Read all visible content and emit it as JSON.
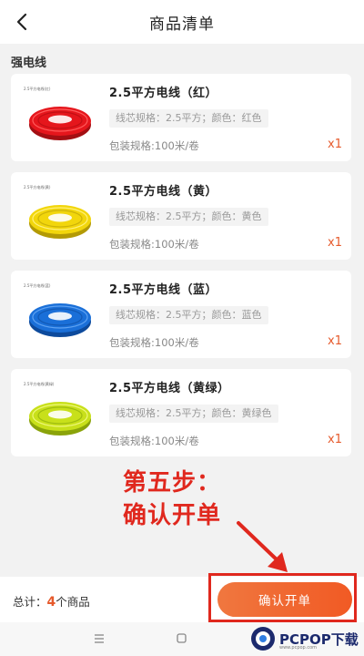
{
  "header": {
    "title": "商品清单"
  },
  "section": {
    "title": "强电线"
  },
  "products": [
    {
      "name": "2.5平方电线（红）",
      "spec": "线芯规格：2.5平方；颜色：红色",
      "pack": "包装规格:100米/卷",
      "qty": "x1",
      "thumb_caption": "2.5平方电线(红)",
      "color": "#e5161c"
    },
    {
      "name": "2.5平方电线（黄）",
      "spec": "线芯规格：2.5平方；颜色：黄色",
      "pack": "包装规格:100米/卷",
      "qty": "x1",
      "thumb_caption": "2.5平方电线(黄)",
      "color": "#f2d60c"
    },
    {
      "name": "2.5平方电线（蓝）",
      "spec": "线芯规格：2.5平方；颜色：蓝色",
      "pack": "包装规格:100米/卷",
      "qty": "x1",
      "thumb_caption": "2.5平方电线(蓝)",
      "color": "#1a6fd8"
    },
    {
      "name": "2.5平方电线（黄绿）",
      "spec": "线芯规格：2.5平方；颜色：黄绿色",
      "pack": "包装规格:100米/卷",
      "qty": "x1",
      "thumb_caption": "2.5平方电线(黄绿)",
      "color": "#c8e01a"
    }
  ],
  "annotation": {
    "line1": "第五步：",
    "line2": "确认开单",
    "color": "#e0281e"
  },
  "footer": {
    "total_prefix": "总计：",
    "total_count": "4",
    "total_suffix": "个商品",
    "confirm_label": "确认开单"
  },
  "watermark": {
    "brand": "PCPOP下载",
    "sub": "www.pcpop.com"
  },
  "colors": {
    "accent": "#e65a2c",
    "button": "#f15a24"
  }
}
